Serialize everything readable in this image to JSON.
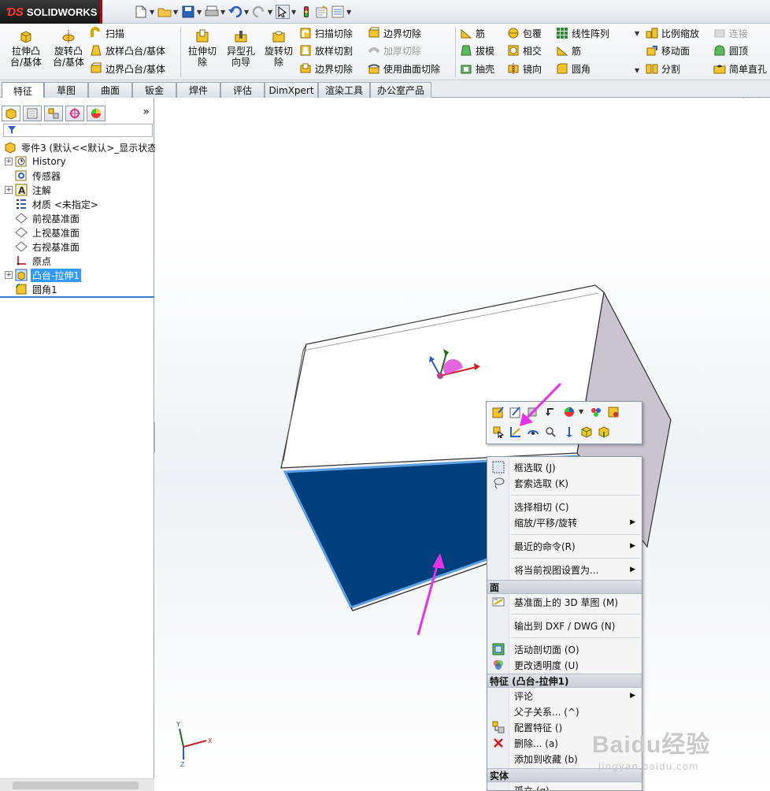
{
  "app": {
    "logo_text": "SOLIDWORKS"
  },
  "ribbon": {
    "extrude_boss": "拉伸凸\n台/基体",
    "revolve_boss": "旋转凸\n台/基体",
    "sweep": "扫描",
    "loft_boss": "放样凸台/基体",
    "boundary_boss": "边界凸台/基体",
    "extrude_cut": "拉伸切\n除",
    "hole_wizard": "异型孔\n向导",
    "revolve_cut": "旋转切\n除",
    "swept_cut": "扫描切除",
    "lofted_cut": "放样切割",
    "boundary_cut": "边界切除",
    "boundary_cut2": "边界切除",
    "thicken_cut": "加厚切除",
    "surface_cut": "使用曲面切除",
    "rib": "筋",
    "draft": "拔模",
    "shell": "抽壳",
    "wrap": "包覆",
    "intersect": "相交",
    "mirror": "镜向",
    "linear_pattern": "线性阵列",
    "rib2": "筋",
    "fillet": "圆角",
    "scale": "比例缩放",
    "move_face": "移动面",
    "split": "分割",
    "connect": "连接",
    "dome": "圆顶",
    "simple_hole": "简单直孔"
  },
  "tabs": [
    "特征",
    "草图",
    "曲面",
    "钣金",
    "焊件",
    "评估",
    "DimXpert",
    "渲染工具",
    "办公室产品"
  ],
  "tree": {
    "root": "零件3 (默认<<默认>_显示状态",
    "items": [
      "History",
      "传感器",
      "注解",
      "材质 <未指定>",
      "前视基准面",
      "上视基准面",
      "右视基准面",
      "原点",
      "凸台-拉伸1",
      "圆角1"
    ]
  },
  "menu": {
    "box_select": "框选取 (J)",
    "lasso_select": "套索选取 (K)",
    "select_tangency": "选择相切 (C)",
    "zoom_pan_rotate": "缩放/平移/旋转",
    "recent_commands": "最近的命令(R)",
    "set_view": "将当前视图设置为...",
    "face_header": "面",
    "sketch_3d": "基准面上的 3D 草图 (M)",
    "export_dxf": "输出到 DXF / DWG (N)",
    "section_plane": "活动剖切面 (O)",
    "transparency": "更改透明度 (U)",
    "feature_header": "特征 (凸台-拉伸1)",
    "comment": "评论",
    "parent_child": "父子关系... (^)",
    "config_feature": "配置特征 ()",
    "delete": "删除... (a)",
    "add_favorite": "添加到收藏 (b)",
    "body_header": "实体",
    "isolate": "孤立 (q)"
  },
  "watermark": {
    "brand": "Baidu经验",
    "url": "jingyan.baidu.com"
  },
  "colors": {
    "selected_face": "#003e7e",
    "tree_selection": "#3399ff",
    "annotation_arrow": "#e233e8",
    "accent_red": "#c4000a"
  }
}
